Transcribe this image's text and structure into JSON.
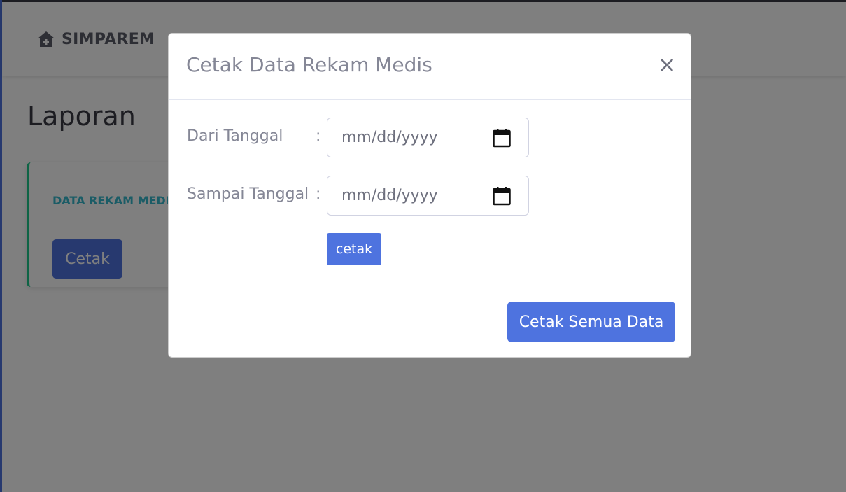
{
  "app": {
    "brand": "SIMPAREM",
    "brand_icon": "clinic-house-icon"
  },
  "page": {
    "title": "Laporan"
  },
  "card": {
    "label": "DATA REKAM MEDIS",
    "button_label": "Cetak"
  },
  "modal": {
    "title": "Cetak Data Rekam Medis",
    "close_label": "×",
    "from": {
      "label": "Dari Tanggal",
      "colon": ":",
      "placeholder": "mm/dd/yyyy"
    },
    "to": {
      "label": "Sampai Tanggal",
      "colon": ":",
      "placeholder": "mm/dd/yyyy"
    },
    "print_button": "cetak",
    "print_all_button": "Cetak Semua Data"
  },
  "colors": {
    "primary": "#4e73df",
    "success_border": "#1cc88a",
    "info_text": "#36b9cc",
    "muted_text": "#858796"
  }
}
